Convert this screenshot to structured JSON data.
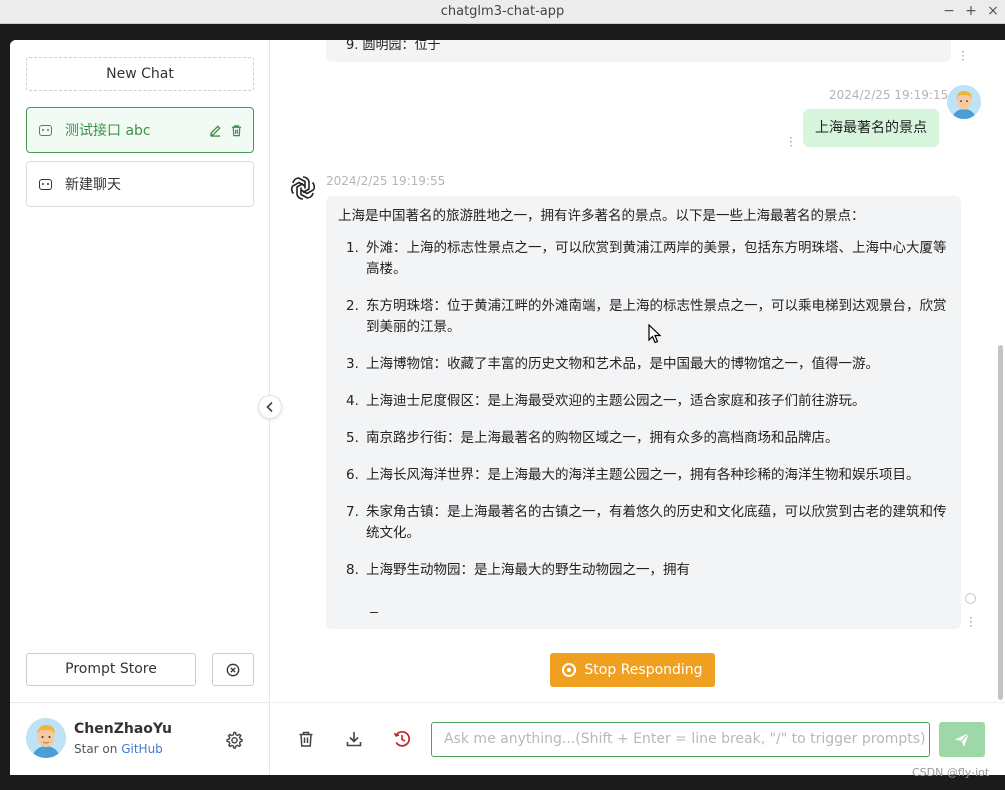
{
  "window": {
    "title": "chatglm3-chat-app",
    "buttons": [
      "−",
      "+",
      "×"
    ]
  },
  "sidebar": {
    "new_chat_label": "New Chat",
    "chats": [
      {
        "label": "测试接口 abc",
        "active": true
      },
      {
        "label": "新建聊天",
        "active": false
      }
    ],
    "prompt_store_label": "Prompt Store",
    "user": {
      "name": "ChenZhaoYu",
      "star_prefix": "Star on",
      "github_label": "GitHub"
    }
  },
  "conversation": {
    "previous_fragment": "9.  圆明园：位于",
    "user_message": {
      "time": "2024/2/25 19:19:15",
      "text": "上海最著名的景点"
    },
    "bot_message": {
      "time": "2024/2/25 19:19:55",
      "intro": "上海是中国著名的旅游胜地之一，拥有许多著名的景点。以下是一些上海最著名的景点：",
      "items": [
        {
          "num": "1.",
          "text": "外滩：上海的标志性景点之一，可以欣赏到黄浦江两岸的美景，包括东方明珠塔、上海中心大厦等高楼。"
        },
        {
          "num": "2.",
          "text": "东方明珠塔：位于黄浦江畔的外滩南端，是上海的标志性景点之一，可以乘电梯到达观景台，欣赏到美丽的江景。"
        },
        {
          "num": "3.",
          "text": "上海博物馆：收藏了丰富的历史文物和艺术品，是中国最大的博物馆之一，值得一游。"
        },
        {
          "num": "4.",
          "text": "上海迪士尼度假区：是上海最受欢迎的主题公园之一，适合家庭和孩子们前往游玩。"
        },
        {
          "num": "5.",
          "text": "南京路步行街：是上海最著名的购物区域之一，拥有众多的高档商场和品牌店。"
        },
        {
          "num": "6.",
          "text": "上海长风海洋世界：是上海最大的海洋主题公园之一，拥有各种珍稀的海洋生物和娱乐项目。"
        },
        {
          "num": "7.",
          "text": "朱家角古镇：是上海最著名的古镇之一，有着悠久的历史和文化底蕴，可以欣赏到古老的建筑和传统文化。"
        },
        {
          "num": "8.",
          "text": "上海野生动物园：是上海最大的野生动物园之一，拥有"
        }
      ]
    },
    "stop_label": "Stop Responding"
  },
  "composer": {
    "placeholder": "Ask me anything...(Shift + Enter = line break, \"/\" to trigger prompts)"
  },
  "watermark": "CSDN @fly-iot",
  "colors": {
    "accent_green": "#4d9a58",
    "stop_orange": "#f0a020",
    "send_green": "#9fd8a8",
    "user_bubble": "#d7f5dc"
  }
}
